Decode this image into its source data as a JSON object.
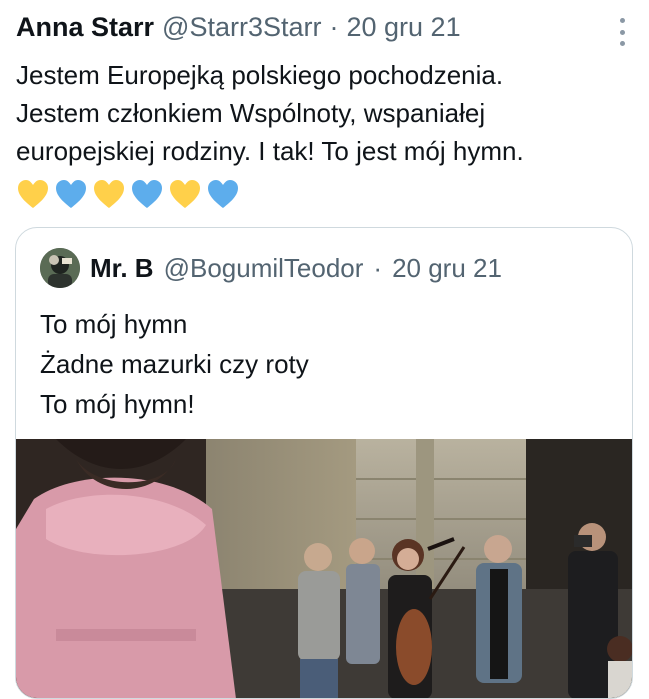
{
  "tweet": {
    "author_name": "Anna Starr",
    "author_handle": "@Starr3Starr",
    "separator": "·",
    "date": "20 gru 21",
    "text_lines": [
      "Jestem Europejką polskiego pochodzenia.",
      "Jestem członkiem Wspólnoty,  wspaniałej",
      "europejskiej rodziny. I tak! To jest mój hymn."
    ],
    "hearts": [
      "yellow-heart",
      "blue-heart",
      "yellow-heart",
      "blue-heart",
      "yellow-heart",
      "blue-heart"
    ],
    "colors": {
      "yellow": "#ffd04a",
      "blue": "#5dadec"
    }
  },
  "quoted": {
    "author_name": "Mr. B",
    "author_handle": "@BogumilTeodor",
    "separator": "·",
    "date": "20 gru 21",
    "text_lines": [
      "To mój hymn",
      "Żadne mazurki czy roty",
      "To mój hymn!"
    ]
  }
}
